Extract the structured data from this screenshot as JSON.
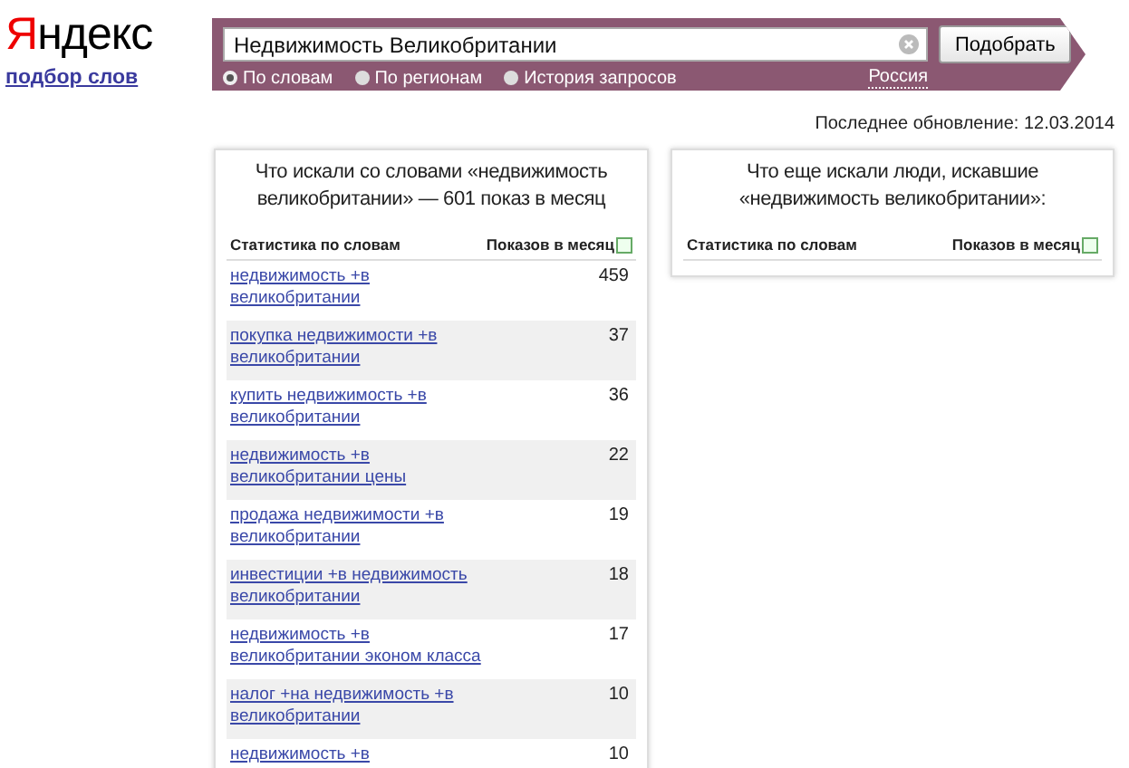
{
  "logo": "Яндекс",
  "service_link": "подбор слов",
  "search": {
    "value": "Недвижимость Великобритании",
    "button": "Подобрать",
    "modes": [
      {
        "label": "По словам",
        "selected": true
      },
      {
        "label": "По регионам",
        "selected": false
      },
      {
        "label": "История запросов",
        "selected": false
      }
    ],
    "region": "Россия"
  },
  "last_update": "Последнее обновление:  12.03.2014",
  "left_panel": {
    "title": "Что искали со словами «недвижимость великобритании» — 601 показ в месяц",
    "columns": [
      "Статистика по словам",
      "Показов в месяц"
    ],
    "rows": [
      {
        "query": "недвижимость +в великобритании",
        "count": "459"
      },
      {
        "query": "покупка недвижимости +в великобритании",
        "count": "37"
      },
      {
        "query": "купить недвижимость +в великобритании",
        "count": "36"
      },
      {
        "query": "недвижимость +в великобритании цены",
        "count": "22"
      },
      {
        "query": "продажа недвижимости +в великобритании",
        "count": "19"
      },
      {
        "query": "инвестиции +в недвижимость великобритании",
        "count": "18"
      },
      {
        "query": "недвижимость +в великобритании эконом класса",
        "count": "17"
      },
      {
        "query": "налог +на недвижимость +в великобритании",
        "count": "10"
      },
      {
        "query": "недвижимость +в",
        "count": "10"
      }
    ]
  },
  "right_panel": {
    "title": "Что еще искали люди, искавшие «недвижимость великобритании»:",
    "columns": [
      "Статистика по словам",
      "Показов в месяц"
    ]
  }
}
